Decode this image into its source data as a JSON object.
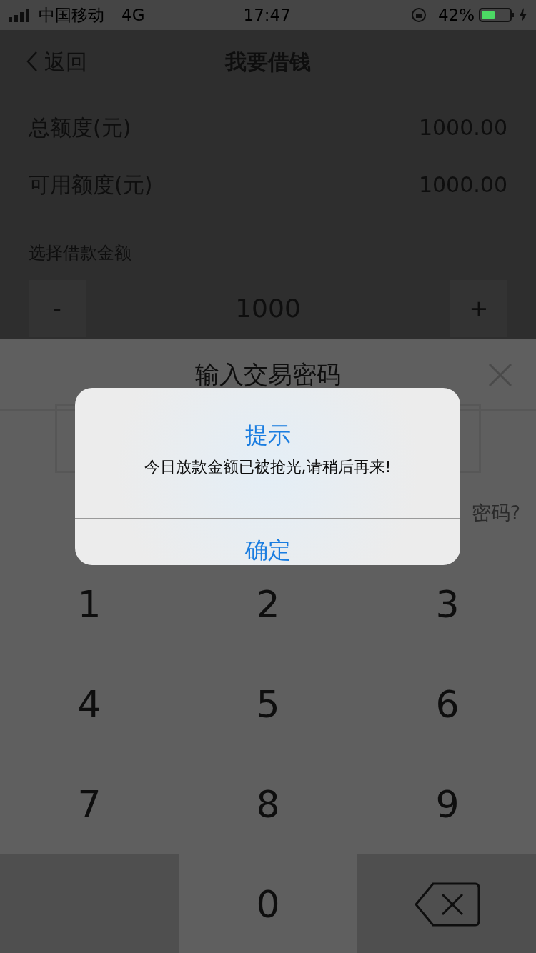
{
  "status_bar": {
    "carrier": "中国移动",
    "network": "4G",
    "time": "17:47",
    "battery": "42%"
  },
  "nav": {
    "back": "返回",
    "title": "我要借钱"
  },
  "rows": [
    {
      "label": "总额度(元)",
      "value": "1000.00"
    },
    {
      "label": "可用额度(元)",
      "value": "1000.00"
    }
  ],
  "amount": {
    "label": "选择借款金额",
    "minus": "-",
    "value": "1000",
    "plus": "+"
  },
  "sheet": {
    "title": "输入交易密码",
    "forgot": "密码?"
  },
  "keypad": [
    {
      "kind": "digit",
      "label": "1"
    },
    {
      "kind": "digit",
      "label": "2"
    },
    {
      "kind": "digit",
      "label": "3"
    },
    {
      "kind": "digit",
      "label": "4"
    },
    {
      "kind": "digit",
      "label": "5"
    },
    {
      "kind": "digit",
      "label": "6"
    },
    {
      "kind": "digit",
      "label": "7"
    },
    {
      "kind": "digit",
      "label": "8"
    },
    {
      "kind": "digit",
      "label": "9"
    },
    {
      "kind": "blank"
    },
    {
      "kind": "digit",
      "label": "0"
    },
    {
      "kind": "backspace"
    }
  ],
  "dialog": {
    "title": "提示",
    "message": "今日放款金额已被抢光,请稍后再来!",
    "button": "确定"
  }
}
